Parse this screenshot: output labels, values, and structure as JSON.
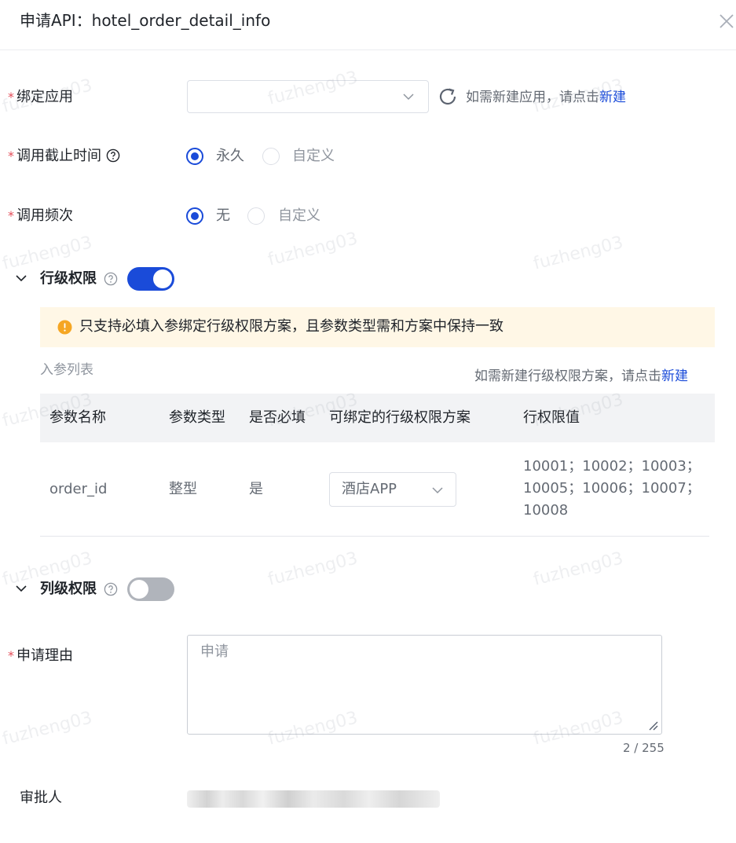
{
  "dialog": {
    "title": "申请API：hotel_order_detail_info"
  },
  "form": {
    "bind_app": {
      "label": "绑定应用",
      "value": "",
      "hint_prefix": "如需新建应用，请点击",
      "hint_link": "新建"
    },
    "deadline": {
      "label": "调用截止时间",
      "options": [
        "永久",
        "自定义"
      ],
      "selected": "永久"
    },
    "frequency": {
      "label": "调用频次",
      "options": [
        "无",
        "自定义"
      ],
      "selected": "无"
    },
    "row_permission": {
      "title": "行级权限",
      "enabled": true,
      "alert": "只支持必填入参绑定行级权限方案，且参数类型需和方案中保持一致",
      "table_title": "入参列表",
      "hint_prefix": "如需新建行级权限方案，请点击",
      "hint_link": "新建",
      "columns": [
        "参数名称",
        "参数类型",
        "是否必填",
        "可绑定的行级权限方案",
        "行权限值"
      ],
      "rows": [
        {
          "name": "order_id",
          "type": "整型",
          "required": "是",
          "scheme": "酒店APP",
          "values_line1": "10001；10002；10003；",
          "values_line2": "10005；10006；10007；",
          "values_line3": "10008"
        }
      ]
    },
    "column_permission": {
      "title": "列级权限",
      "enabled": false
    },
    "reason": {
      "label": "申请理由",
      "value": "申请",
      "counter": "2 / 255"
    },
    "approver": {
      "label": "审批人"
    }
  },
  "watermark": "fuzheng03",
  "colors": {
    "primary": "#1a4bd9",
    "required": "#e34d59",
    "warning": "#f5a623",
    "alert_bg": "#fff7e6"
  }
}
